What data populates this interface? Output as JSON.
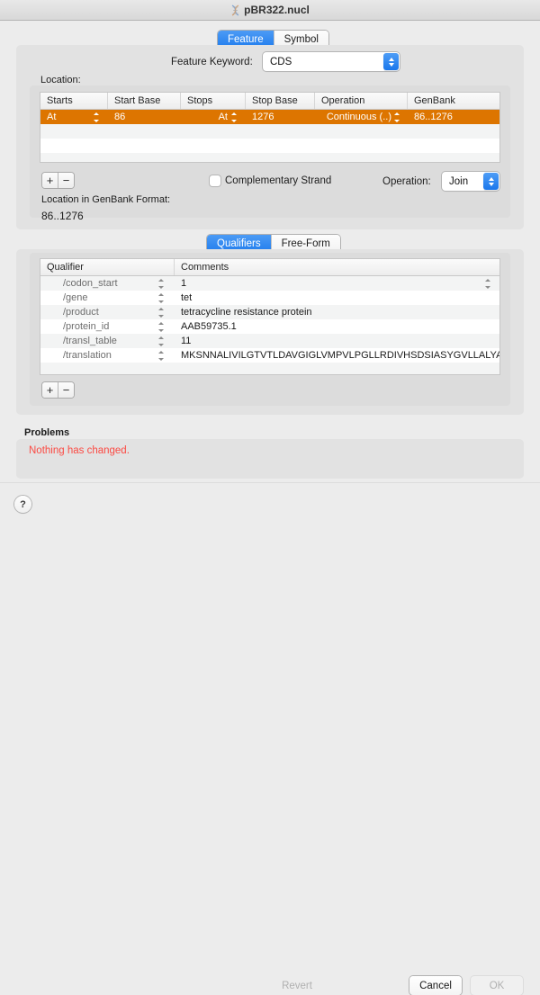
{
  "window": {
    "title": "pBR322.nucl",
    "icon": "dna-sequence-icon"
  },
  "top_tabs": {
    "items": [
      {
        "label": "Feature",
        "selected": true
      },
      {
        "label": "Symbol",
        "selected": false
      }
    ]
  },
  "feature_keyword": {
    "label": "Feature Keyword:",
    "value": "CDS"
  },
  "location": {
    "label": "Location:",
    "columns": [
      "Starts",
      "Start Base",
      "Stops",
      "Stop Base",
      "Operation",
      "GenBank"
    ],
    "rows": [
      {
        "starts": "At",
        "start_base": "86",
        "stops": "At",
        "stop_base": "1276",
        "operation": "Continuous (..)",
        "genbank": "86..1276",
        "selected": true
      }
    ],
    "add_label": "+",
    "remove_label": "−",
    "complementary_strand": {
      "label": "Complementary Strand",
      "checked": false
    },
    "operation": {
      "label": "Operation:",
      "value": "Join"
    },
    "genbank_format_label": "Location in GenBank Format:",
    "genbank_format_value": "86..1276"
  },
  "qualifier_tabs": {
    "items": [
      {
        "label": "Qualifiers",
        "selected": true
      },
      {
        "label": "Free-Form",
        "selected": false
      }
    ]
  },
  "qualifiers": {
    "columns": [
      "Qualifier",
      "Comments"
    ],
    "rows": [
      {
        "qualifier": "/codon_start",
        "comment": "1"
      },
      {
        "qualifier": "/gene",
        "comment": "tet"
      },
      {
        "qualifier": "/product",
        "comment": "tetracycline resistance protein"
      },
      {
        "qualifier": "/protein_id",
        "comment": "AAB59735.1"
      },
      {
        "qualifier": "/transl_table",
        "comment": "11"
      },
      {
        "qualifier": "/translation",
        "comment": "MKSNNALIVILGTVTLDAVGIGLVMPVLPGLLRDIVHSDSIASYGVLLALYALMQ…"
      }
    ],
    "add_label": "+",
    "remove_label": "−"
  },
  "problems": {
    "label": "Problems",
    "message": "Nothing has changed."
  },
  "footer": {
    "help_label": "?",
    "revert_label": "Revert",
    "cancel_label": "Cancel",
    "ok_label": "OK"
  },
  "colors": {
    "selection_orange": "#dd7500",
    "accent_blue": "#1f7ced",
    "error_red": "#fb4a43"
  }
}
